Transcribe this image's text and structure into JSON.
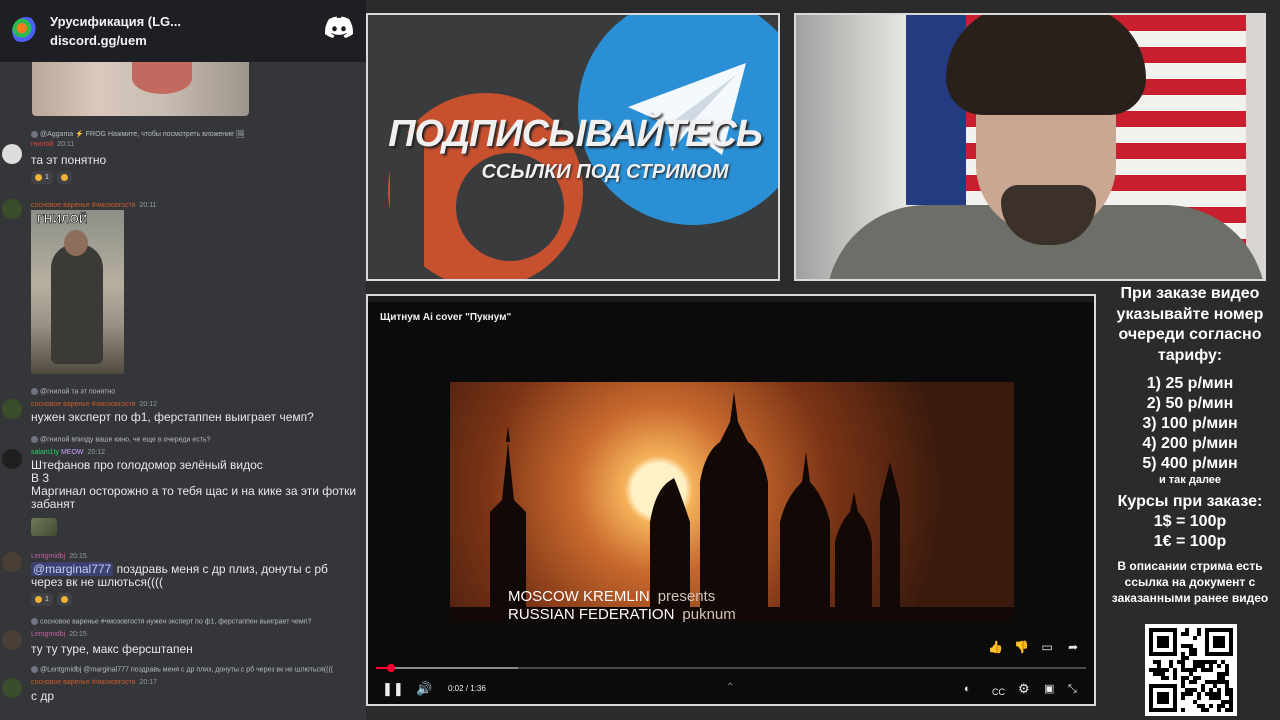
{
  "discord": {
    "server_name": "Урусификация (LG...",
    "invite": "discord.gg/uem",
    "messages": [
      {
        "reply": "@Aggama ⚡ FROG  Нажмите, чтобы посмотреть вложение 🖼",
        "user": "гнилой",
        "user_color": "#e0483e",
        "time": "20:11",
        "text": "та эт понятно",
        "reactions": [
          "1",
          ""
        ]
      },
      {
        "user": "сосновое варенье #чмозовгостя",
        "user_color": "#c95b2a",
        "time": "20:11",
        "photo_tag": "ГНИЛОЙ"
      },
      {
        "reply": "@гнилой та эт понятно",
        "user": "сосновое варенье #чмозовгостя",
        "user_color": "#c95b2a",
        "time": "20:12",
        "text": "нужен эксперт по ф1, ферстаппен выиграет чемп?"
      },
      {
        "reply": "@гнилой впизду ваше кино, че еще в очереди есть?",
        "user": "salam1ty",
        "badge": "MEOW",
        "user_color": "#2ed16b",
        "time": "20:12",
        "text": "Штефанов про голодомор зелёный видос\nВ 3\nМаргинал осторожно а то тебя щас и на кике за эти фотки забанят"
      },
      {
        "user": "Lentgmidbj",
        "user_color": "#c35e9c",
        "time": "20:15",
        "mention": "@marginal777",
        "text": " поздравь меня с др плиз, донуты с рб через вк не шлються((((",
        "reactions": [
          "1",
          ""
        ]
      },
      {
        "reply": "сосновое варенье #чмозовгостя  нужен эксперт по ф1, ферстаппен выиграет чемп?",
        "user": "Lentgmidbj",
        "user_color": "#c35e9c",
        "time": "20:15",
        "text": "ту ту туре, макс ферсштапен"
      },
      {
        "reply": "@Lentgmidbj @marginal777 поздравь меня с др плиз, донуты с рб через вк не шлються((((",
        "user": "сосновое варенье #чмозовгостя",
        "user_color": "#c95b2a",
        "time": "20:17",
        "text": "с др"
      }
    ]
  },
  "banner": {
    "title": "ПОДПИСЫВАЙТЕСЬ",
    "subtitle": "ССЫЛКИ ПОД СТРИМОМ"
  },
  "player": {
    "video_title": "Щитнум Ai cover \"Пукнум\"",
    "credit_line1": "MOSCOW KREMLIN",
    "credit_pres1": "presents",
    "credit_line2": "RUSSIAN FEDERATION",
    "credit_pres2": "puknum",
    "time": "0:02 / 1:36",
    "progress": 0.021,
    "buffered": 0.2,
    "icons": [
      "like-icon",
      "dislike-icon",
      "comment-icon",
      "share-icon"
    ]
  },
  "info": {
    "intro": "При заказе видео указывайте номер очереди согласно тарифу:",
    "tariffs": [
      "1) 25 р/мин",
      "2) 50 р/мин",
      "3) 100 р/мин",
      "4) 200 р/мин",
      "5) 400 р/мин"
    ],
    "etc": "и так далее",
    "courses_title": "Курсы при заказе:",
    "courses": [
      "1$ = 100р",
      "1€ = 100р"
    ],
    "note": "В описании стрима есть ссылка на документ с заказанными ранее видео"
  }
}
